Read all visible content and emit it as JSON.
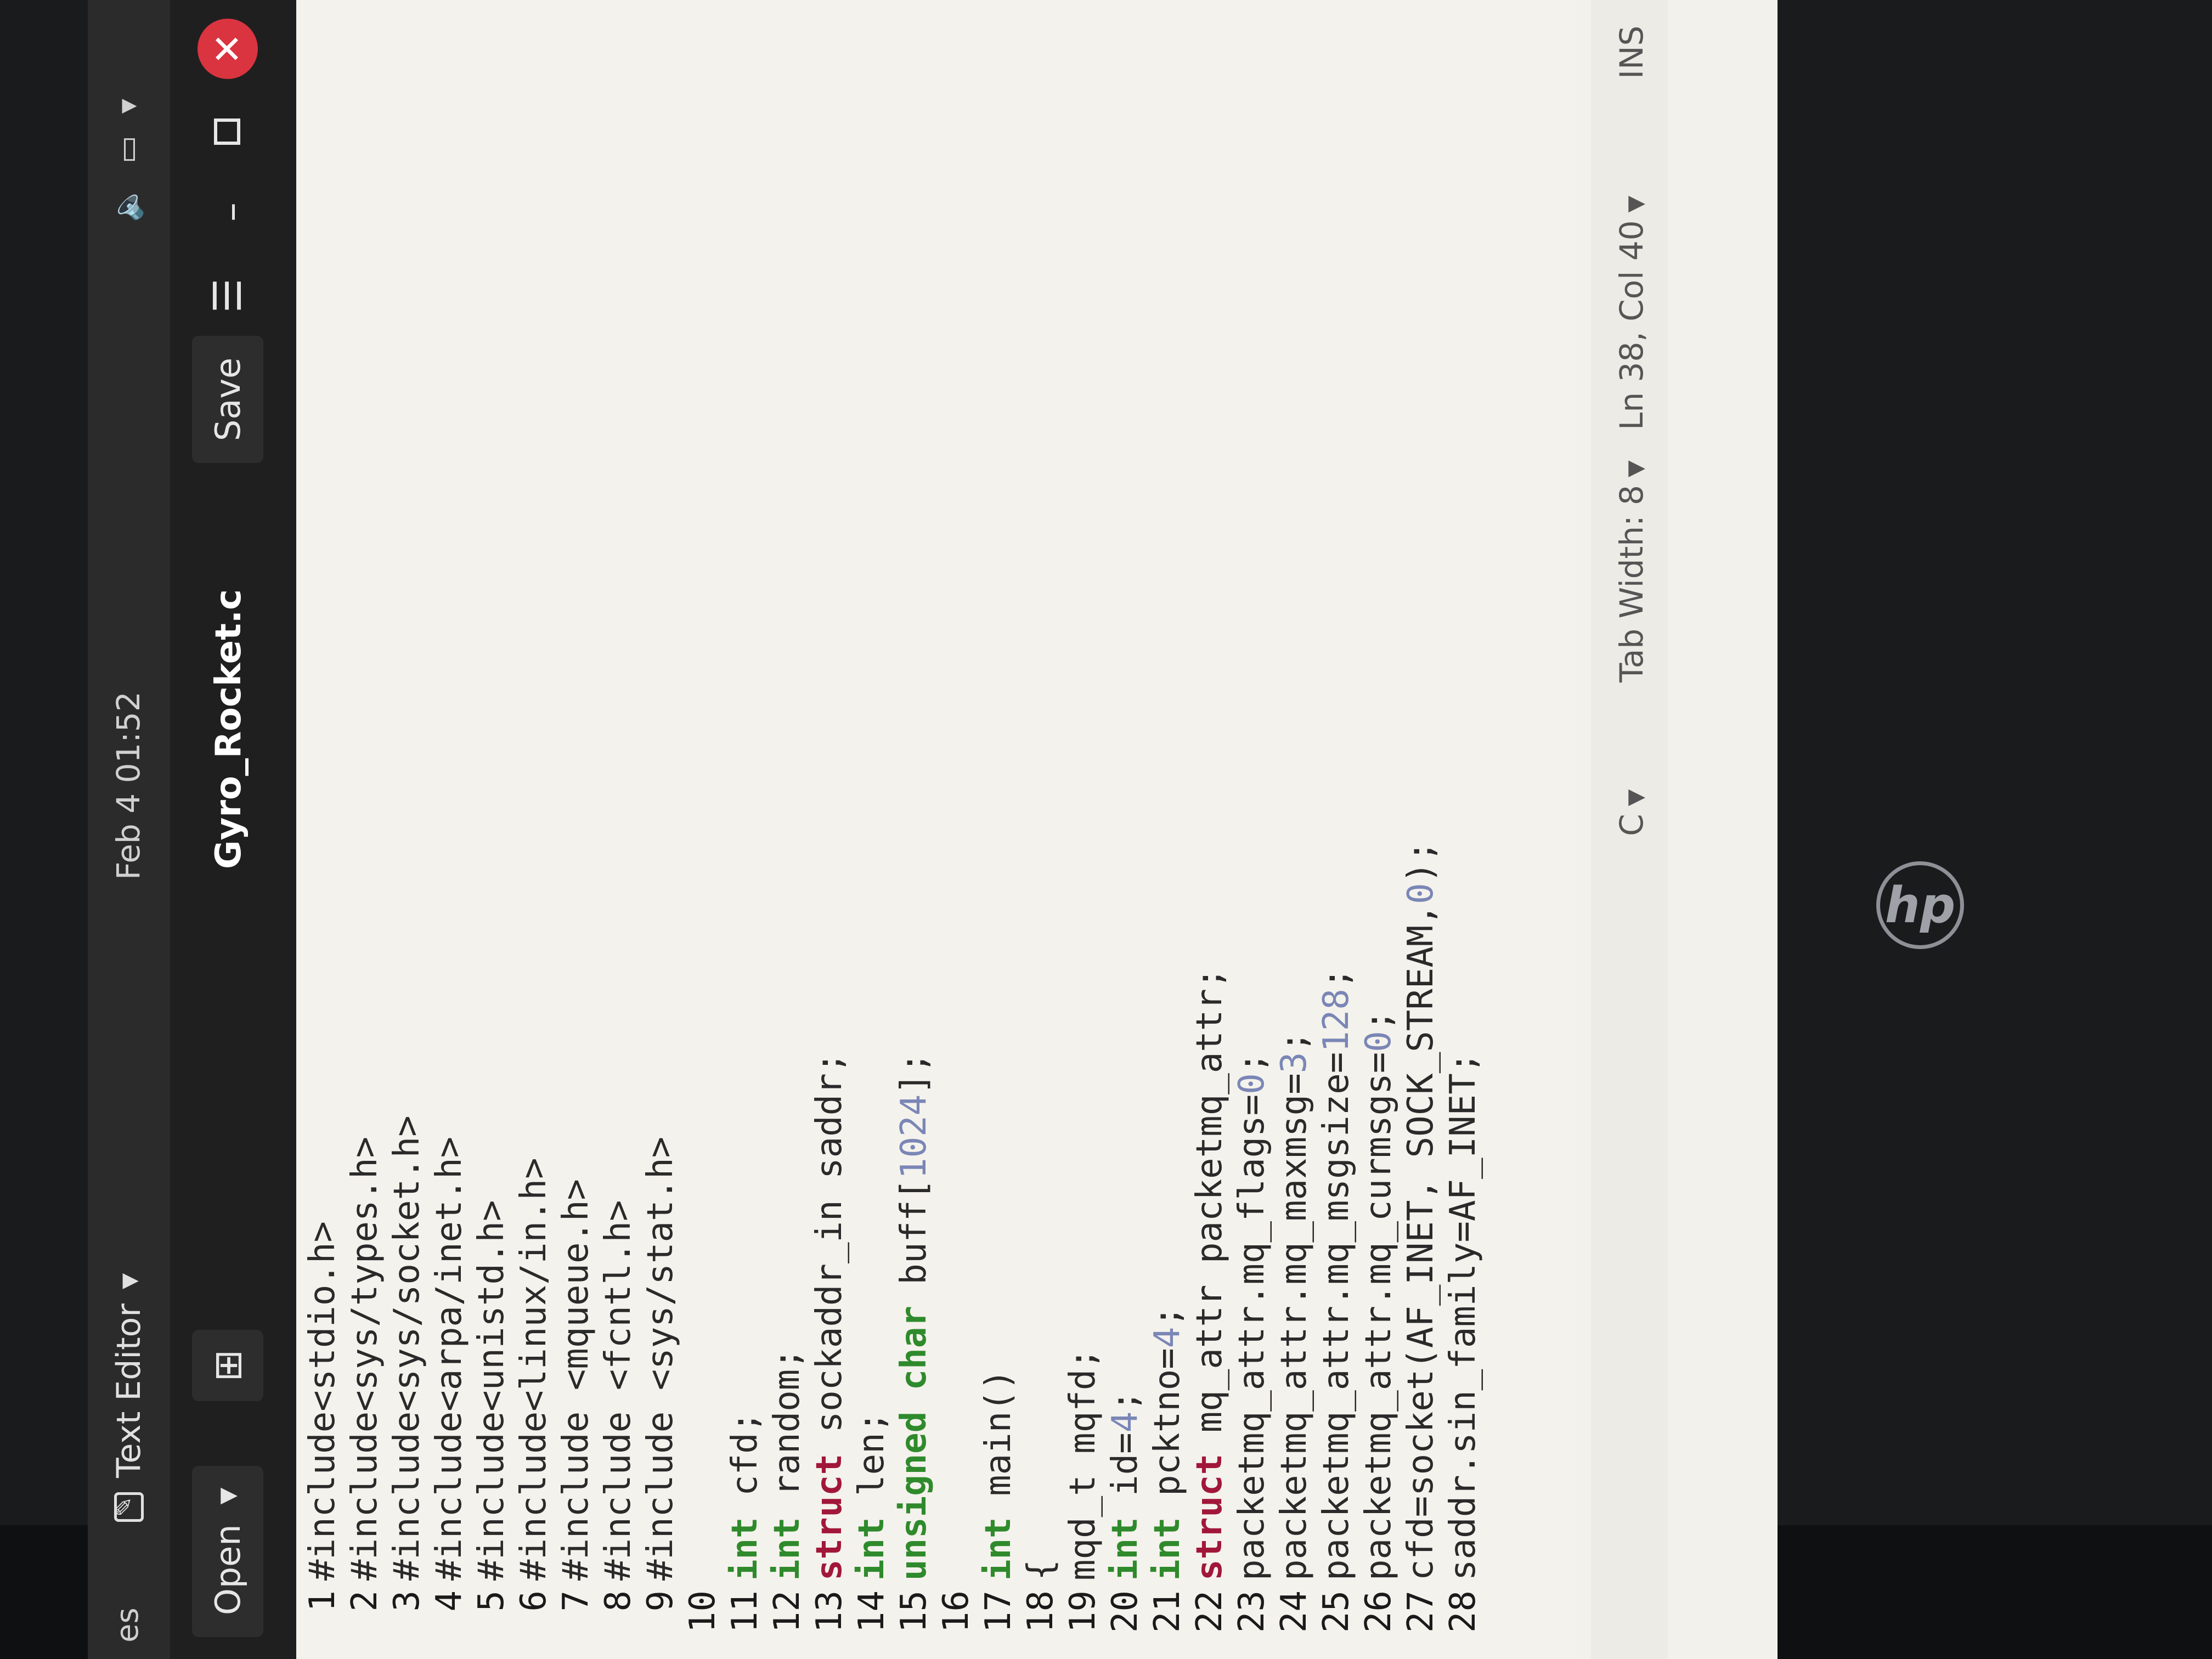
{
  "desktop": {
    "activities_label": "es",
    "brand": "hp"
  },
  "topbar": {
    "app_name": "Text Editor",
    "clock": "Feb 4  01:52"
  },
  "header": {
    "open_label": "Open",
    "title": "Gyro_Rocket.c",
    "save_label": "Save",
    "menu_icon": "hamburger-menu-icon",
    "minimize_icon": "minimize-icon",
    "maximize_icon": "maximize-icon",
    "close_icon": "close-icon"
  },
  "editor": {
    "lines": [
      "#include<stdio.h>",
      "#include<sys/types.h>",
      "#include<sys/socket.h>",
      "#include<arpa/inet.h>",
      "#include<unistd.h>",
      "#include<linux/in.h>",
      "#include <mqueue.h>",
      "#include <fcntl.h>",
      "#include <sys/stat.h>",
      "",
      "int cfd;",
      "int random;",
      "struct sockaddr_in saddr;",
      "int len;",
      "unsigned char buff[1024];",
      "",
      "int main()",
      "{",
      "mqd_t mqfd;",
      "int id=4;",
      "int pcktno=4;",
      "struct mq_attr packetmq_attr;",
      "packetmq_attr.mq_flags=0;",
      "packetmq_attr.mq_maxmsg=3;",
      "packetmq_attr.mq_msgsize=128;",
      "packetmq_attr.mq_curmsgs=0;",
      "cfd=socket(AF_INET, SOCK_STREAM,0);",
      "saddr.sin_family=AF_INET;"
    ]
  },
  "statusbar": {
    "language": "C",
    "tab_width": "Tab Width: 8",
    "cursor": "Ln 38, Col 40",
    "mode": "INS"
  }
}
